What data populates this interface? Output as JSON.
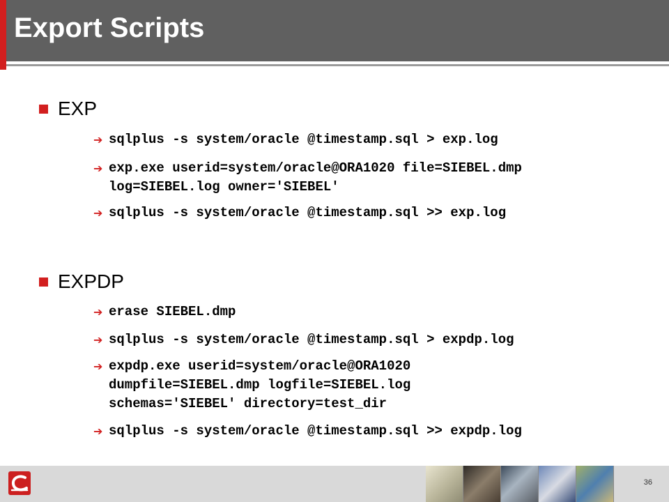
{
  "slide": {
    "title": "Export Scripts",
    "page_number": "36"
  },
  "sections": [
    {
      "label": "EXP",
      "commands": [
        "sqlplus -s system/oracle @timestamp.sql > exp.log",
        "exp.exe userid=system/oracle@ORA1020 file=SIEBEL.dmp\nlog=SIEBEL.log owner='SIEBEL'",
        "sqlplus -s system/oracle @timestamp.sql >> exp.log"
      ]
    },
    {
      "label": "EXPDP",
      "commands": [
        "erase SIEBEL.dmp",
        "sqlplus -s system/oracle @timestamp.sql > expdp.log",
        "expdp.exe userid=system/oracle@ORA1020\ndumpfile=SIEBEL.dmp logfile=SIEBEL.log\nschemas='SIEBEL' directory=test_dir",
        "sqlplus -s system/oracle @timestamp.sql >> expdp.log"
      ]
    }
  ],
  "icons": {
    "section_bullet": "square-bullet-icon",
    "command_bullet": "right-arrow-icon",
    "logo": "company-logo-icon"
  },
  "colors": {
    "accent": "#d21f1f",
    "title_bar": "#606060",
    "footer": "#d9d9d9"
  }
}
